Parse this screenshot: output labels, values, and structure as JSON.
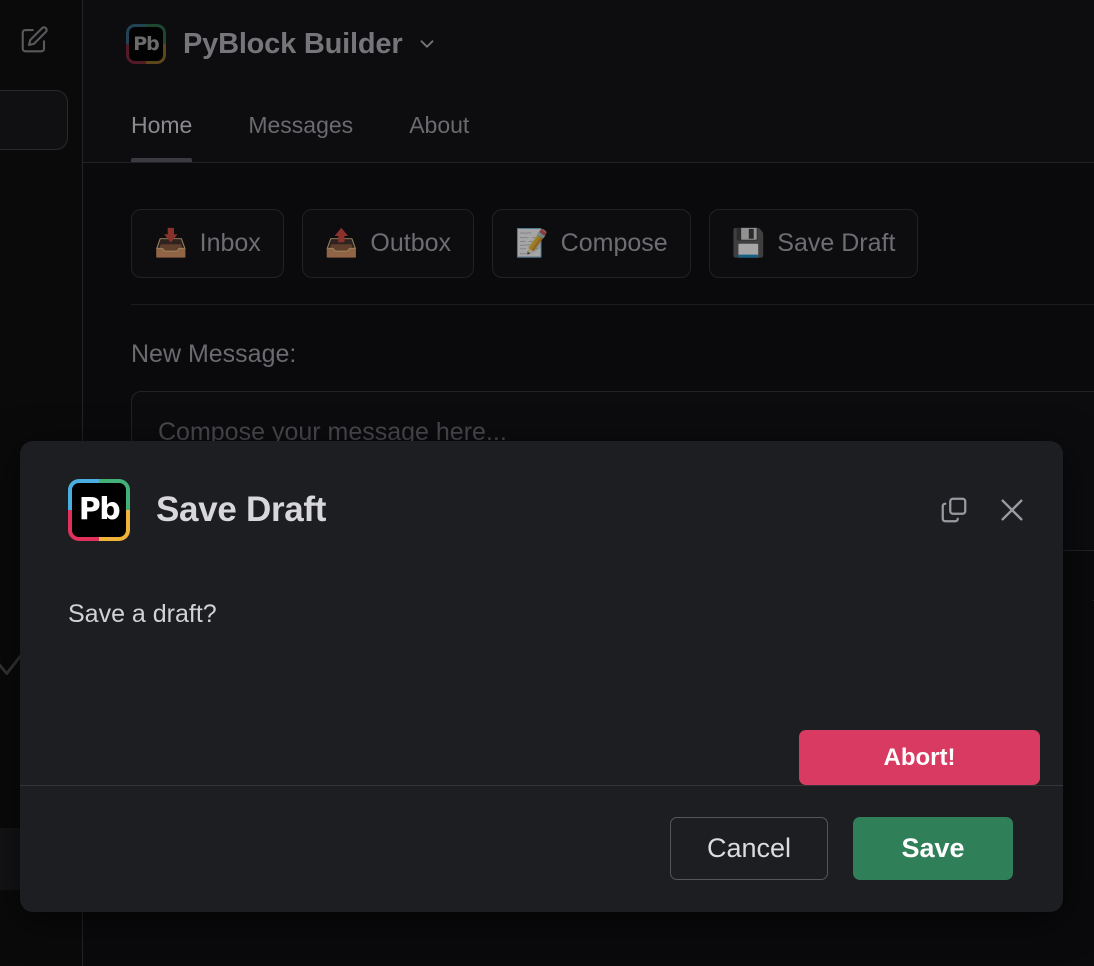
{
  "rail": {
    "edit_icon": "compose-edit-icon",
    "check_icon": "check-icon"
  },
  "header": {
    "logo_text": "Pb",
    "title": "PyBlock Builder",
    "caret_icon": "chevron-down-icon"
  },
  "tabs": [
    {
      "label": "Home",
      "active": true
    },
    {
      "label": "Messages",
      "active": false
    },
    {
      "label": "About",
      "active": false
    }
  ],
  "main": {
    "actions": [
      {
        "label": "Inbox",
        "emoji": "📥",
        "icon": "inbox-tray-icon"
      },
      {
        "label": "Outbox",
        "emoji": "📤",
        "icon": "outbox-tray-icon"
      },
      {
        "label": "Compose",
        "emoji": "📝",
        "icon": "memo-icon"
      },
      {
        "label": "Save Draft",
        "emoji": "💾",
        "icon": "floppy-disk-icon"
      }
    ],
    "field_label": "New Message:",
    "textarea_placeholder": "Compose your message here..."
  },
  "modal": {
    "logo_text": "Pb",
    "title": "Save Draft",
    "copy_icon": "copy-icon",
    "close_icon": "close-icon",
    "body_text": "Save a draft?",
    "abort_label": "Abort!",
    "cancel_label": "Cancel",
    "save_label": "Save"
  },
  "colors": {
    "accent_danger": "#d83a62",
    "accent_success": "#2f8059",
    "modal_bg": "#1d1e21",
    "app_bg": "#0a0a0b"
  }
}
